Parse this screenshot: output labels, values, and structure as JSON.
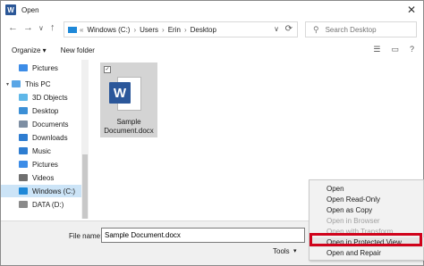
{
  "window": {
    "title": "Open",
    "app_icon": "word-app-icon"
  },
  "address": {
    "drive_icon": "drive-icon",
    "crumbs": [
      "Windows (C:)",
      "Users",
      "Erin",
      "Desktop"
    ],
    "search_placeholder": "Search Desktop"
  },
  "toolbar": {
    "organize": "Organize ▾",
    "new_folder": "New folder"
  },
  "sidebar": {
    "items": [
      {
        "label": "Pictures",
        "icon": "pictures-icon",
        "color": "#3c8ce7"
      },
      {
        "label": "This PC",
        "icon": "this-pc-icon",
        "color": "#5aa6e6"
      },
      {
        "label": "3D Objects",
        "icon": "3d-objects-icon",
        "color": "#5fb7e8"
      },
      {
        "label": "Desktop",
        "icon": "desktop-icon",
        "color": "#3b8fd6"
      },
      {
        "label": "Documents",
        "icon": "documents-icon",
        "color": "#7d8ea3"
      },
      {
        "label": "Downloads",
        "icon": "downloads-icon",
        "color": "#2e7dd1"
      },
      {
        "label": "Music",
        "icon": "music-icon",
        "color": "#2e7dd1"
      },
      {
        "label": "Pictures",
        "icon": "pictures-icon",
        "color": "#3c8ce7"
      },
      {
        "label": "Videos",
        "icon": "videos-icon",
        "color": "#6f6f6f"
      },
      {
        "label": "Windows (C:)",
        "icon": "drive-c-icon",
        "color": "#1e88d8"
      },
      {
        "label": "DATA (D:)",
        "icon": "drive-d-icon",
        "color": "#8a8a8a"
      }
    ]
  },
  "file": {
    "name_line1": "Sample",
    "name_line2": "Document.docx",
    "icon": "word-document-icon"
  },
  "bottom": {
    "file_name_label": "File name:",
    "file_name_value": "Sample Document.docx",
    "tools_label": "Tools"
  },
  "menu": {
    "items": [
      {
        "label": "Open",
        "enabled": true
      },
      {
        "label": "Open Read-Only",
        "enabled": true
      },
      {
        "label": "Open as Copy",
        "enabled": true
      },
      {
        "label": "Open in Browser",
        "enabled": false
      },
      {
        "label": "Open with Transform",
        "enabled": false
      },
      {
        "label": "Open in Protected View",
        "enabled": true
      },
      {
        "label": "Open and Repair",
        "enabled": true
      }
    ],
    "highlight_color": "#d0021b"
  }
}
